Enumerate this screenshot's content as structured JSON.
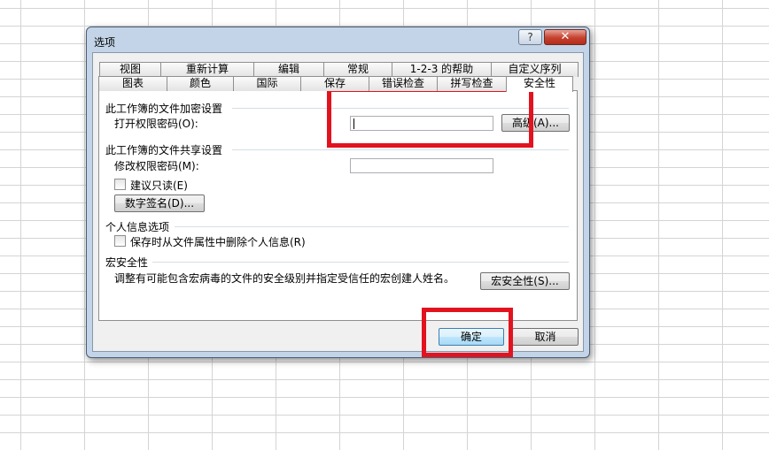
{
  "dialog": {
    "title": "选项",
    "help_label": "?",
    "close_label": "✕"
  },
  "tabs": {
    "back_row": [
      "视图",
      "重新计算",
      "编辑",
      "常规",
      "1-2-3 的帮助",
      "自定义序列"
    ],
    "front_row": [
      "图表",
      "颜色",
      "国际",
      "保存",
      "错误检查",
      "拼写检查",
      "安全性"
    ],
    "active": "安全性"
  },
  "security": {
    "encrypt_section": "此工作簿的文件加密设置",
    "open_password_label": "打开权限密码(O):",
    "open_password_value": "",
    "advanced_button": "高级(A)...",
    "share_section": "此工作簿的文件共享设置",
    "modify_password_label": "修改权限密码(M):",
    "modify_password_value": "",
    "readonly_label": "建议只读(E)",
    "readonly_checked": false,
    "digital_signature_button": "数字签名(D)...",
    "privacy_section": "个人信息选项",
    "remove_info_label": "保存时从文件属性中删除个人信息(R)",
    "remove_info_checked": false,
    "macro_section": "宏安全性",
    "macro_description": "调整有可能包含宏病毒的文件的安全级别并指定受信任的宏创建人姓名。",
    "macro_button": "宏安全性(S)..."
  },
  "footer": {
    "ok_button": "确定",
    "cancel_button": "取消"
  },
  "colors": {
    "highlight": "#e2131f",
    "dialog_frame": "#c3d4e8"
  }
}
